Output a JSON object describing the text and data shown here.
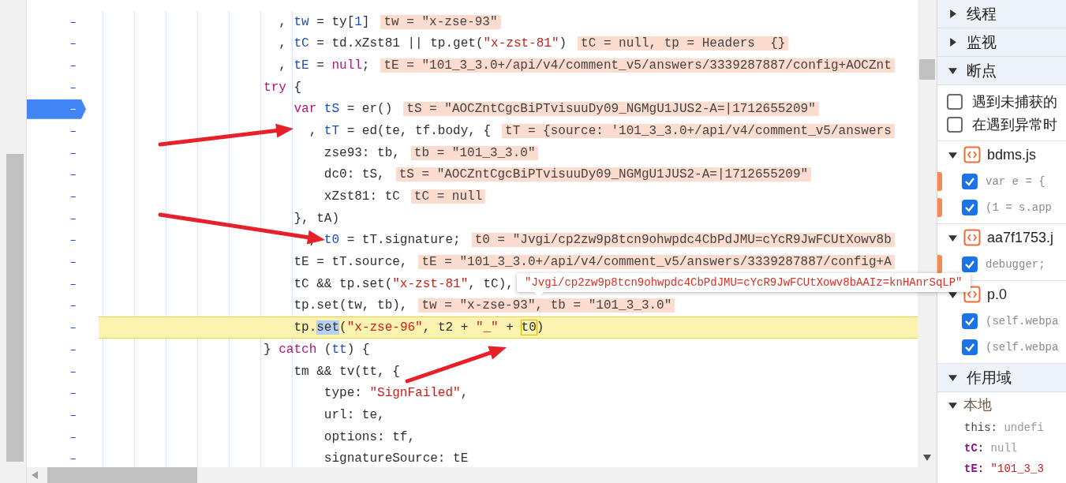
{
  "editor": {
    "lines": [
      {
        "children": [
          {
            "number": "–",
            "tokens": [
              {
                "kind": "plain",
                "text": ", "
              },
              {
                "kind": "var",
                "text": "tw"
              },
              {
                "kind": "plain",
                "text": " = ty["
              },
              {
                "kind": "num",
                "text": "1"
              },
              {
                "kind": "plain",
                "text": "]"
              }
            ],
            "value": "tw = \"x-zse-93\"",
            "paused": false,
            "highlighted": false
          },
          {
            "number": "–",
            "tokens": [
              {
                "kind": "plain",
                "text": ", "
              },
              {
                "kind": "var",
                "text": "tC"
              },
              {
                "kind": "plain",
                "text": " = td.xZst81 || tp.get("
              },
              {
                "kind": "str",
                "text": "\"x-zst-81\""
              },
              {
                "kind": "plain",
                "text": ")"
              }
            ],
            "value": "tC = null, tp = Headers  {}",
            "paused": false,
            "highlighted": false
          },
          {
            "number": "–",
            "tokens": [
              {
                "kind": "plain",
                "text": ", "
              },
              {
                "kind": "var",
                "text": "tE"
              },
              {
                "kind": "plain",
                "text": " = "
              },
              {
                "kind": "kw",
                "text": "null"
              },
              {
                "kind": "plain",
                "text": ";"
              }
            ],
            "value": "tE = \"101_3_3.0+/api/v4/comment_v5/answers/3339287887/config+AOCZnt",
            "paused": false,
            "highlighted": false
          }
        ]
      },
      {
        "number": "–",
        "tokens": [
          {
            "kind": "kw",
            "text": "try"
          },
          {
            "kind": "plain",
            "text": " {"
          }
        ],
        "paused": false,
        "highlighted": false,
        "children": [
          {
            "children": [
              {
                "number": "–",
                "tokens": [
                  {
                    "kind": "kw",
                    "text": "var"
                  },
                  {
                    "kind": "var",
                    "text": " tS"
                  },
                  {
                    "kind": "plain",
                    "text": " = er()"
                  }
                ],
                "value": "tS = \"AOCZntCgcBiPTvisuuDy09_NGMgU1JUS2-A=|1712655209\"",
                "paused": true,
                "highlighted": false,
                "children": [
                  {
                    "number": "–",
                    "tokens": [
                      {
                        "kind": "plain",
                        "text": ", "
                      },
                      {
                        "kind": "var",
                        "text": "tT"
                      },
                      {
                        "kind": "plain",
                        "text": " = ed(te, tf.body, {"
                      }
                    ],
                    "value": "tT = {source: '101_3_3.0+/api/v4/comment_v5/answers",
                    "paused": false,
                    "highlighted": false,
                    "children": [
                      {
                        "number": "–",
                        "tokens": [
                          {
                            "kind": "plain",
                            "text": "zse93: tb,"
                          }
                        ],
                        "value": "tb = \"101_3_3.0\"",
                        "paused": false,
                        "highlighted": false
                      },
                      {
                        "number": "–",
                        "tokens": [
                          {
                            "kind": "plain",
                            "text": "dc0: tS,"
                          }
                        ],
                        "value": "tS = \"AOCZntCgcBiPTvisuuDy09_NGMgU1JUS2-A=|1712655209\"",
                        "paused": false,
                        "highlighted": false
                      },
                      {
                        "number": "–",
                        "tokens": [
                          {
                            "kind": "plain",
                            "text": "xZst81: tC"
                          }
                        ],
                        "value": "tC = null",
                        "paused": false,
                        "highlighted": false
                      }
                    ]
                  }
                ]
              },
              {
                "number": "–",
                "tokens": [
                  {
                    "kind": "plain",
                    "text": "}, tA)"
                  }
                ],
                "paused": false,
                "highlighted": false,
                "children": [
                  {
                    "number": "–",
                    "tokens": [
                      {
                        "kind": "plain",
                        "text": ", "
                      },
                      {
                        "kind": "var",
                        "text": "t0"
                      },
                      {
                        "kind": "plain",
                        "text": " = tT.signature;"
                      }
                    ],
                    "value": "t0 = \"Jvgi/cp2zw9p8tcn9ohwpdc4CbPdJMU=cYcR9JwFCUtXowv8b",
                    "paused": false,
                    "highlighted": false
                  }
                ]
              },
              {
                "number": "–",
                "tokens": [
                  {
                    "kind": "plain",
                    "text": "tE = tT.source,"
                  }
                ],
                "value": "tE = \"101_3_3.0+/api/v4/comment_v5/answers/3339287887/config+A",
                "paused": false,
                "highlighted": false
              },
              {
                "number": "–",
                "tokens": [
                  {
                    "kind": "plain",
                    "text": "tC && tp.set("
                  },
                  {
                    "kind": "str",
                    "text": "\"x-zst-81\""
                  },
                  {
                    "kind": "plain",
                    "text": ", tC),"
                  }
                ],
                "paused": false,
                "highlighted": false
              },
              {
                "number": "–",
                "tokens": [
                  {
                    "kind": "plain",
                    "text": "tp.set(tw, tb),"
                  }
                ],
                "value": "tw = \"x-zse-93\", tb = \"101_3_3.0\"",
                "paused": false,
                "highlighted": false
              },
              {
                "number": "–",
                "tokens": [
                  {
                    "kind": "plain",
                    "text": "tp."
                  },
                  {
                    "kind": "selection",
                    "text": "set"
                  },
                  {
                    "kind": "plain",
                    "text": "("
                  },
                  {
                    "kind": "str",
                    "text": "\"x-zse-96\""
                  },
                  {
                    "kind": "plain",
                    "text": ", t2 + "
                  },
                  {
                    "kind": "str",
                    "text": "\"_\""
                  },
                  {
                    "kind": "plain",
                    "text": " + "
                  },
                  {
                    "kind": "match",
                    "text": "t0"
                  },
                  {
                    "kind": "plain",
                    "text": ")"
                  }
                ],
                "paused": false,
                "highlighted": true
              }
            ]
          }
        ]
      },
      {
        "number": "–",
        "tokens": [
          {
            "kind": "plain",
            "text": "} "
          },
          {
            "kind": "kw",
            "text": "catch"
          },
          {
            "kind": "plain",
            "text": " ("
          },
          {
            "kind": "var",
            "text": "tt"
          },
          {
            "kind": "plain",
            "text": ") {"
          }
        ],
        "paused": false,
        "highlighted": false,
        "children": [
          {
            "children": [
              {
                "number": "–",
                "tokens": [
                  {
                    "kind": "plain",
                    "text": "tm && tv(tt, {"
                  }
                ],
                "paused": false,
                "highlighted": false,
                "children": [
                  {
                    "children": [
                      {
                        "number": "–",
                        "tokens": [
                          {
                            "kind": "plain",
                            "text": "type: "
                          },
                          {
                            "kind": "str",
                            "text": "\"SignFailed\""
                          },
                          {
                            "kind": "plain",
                            "text": ","
                          }
                        ],
                        "paused": false,
                        "highlighted": false
                      },
                      {
                        "number": "–",
                        "tokens": [
                          {
                            "kind": "plain",
                            "text": "url: te,"
                          }
                        ],
                        "paused": false,
                        "highlighted": false
                      },
                      {
                        "number": "–",
                        "tokens": [
                          {
                            "kind": "plain",
                            "text": "options: tf,"
                          }
                        ],
                        "paused": false,
                        "highlighted": false
                      },
                      {
                        "number": "–",
                        "tokens": [
                          {
                            "kind": "plain",
                            "text": "signatureSource: tE"
                          }
                        ],
                        "paused": false,
                        "highlighted": false
                      }
                    ]
                  }
                ]
              }
            ]
          }
        ]
      }
    ],
    "tooltip": {
      "text": "\"Jvgi/cp2zw9p8tcn9ohwpdc4CbPdJMU=cYcR9JwFCUtXowv8bAAIz=knHAnrSqLP\""
    }
  },
  "sidebar": {
    "sections": [
      {
        "title": "线程",
        "expanded": false
      },
      {
        "title": "监视",
        "expanded": false
      },
      {
        "title": "断点",
        "expanded": true,
        "options": [
          {
            "label": "遇到未捕获的",
            "checked": false
          },
          {
            "label": "在遇到异常时",
            "checked": false
          }
        ],
        "files": [
          {
            "name": "bdms.js",
            "expanded": true,
            "breakpoints": [
              {
                "code": "var e = {",
                "checked": true,
                "flagged": true
              },
              {
                "code": "(1 = s.app",
                "checked": true,
                "flagged": true
              }
            ]
          },
          {
            "name": "aa7f1753.j",
            "expanded": true,
            "breakpoints": [
              {
                "code": "debugger;",
                "checked": true,
                "flagged": true
              }
            ]
          },
          {
            "name": "p.0",
            "expanded": true,
            "breakpoints": [
              {
                "code": "(self.webpa",
                "checked": true,
                "flagged": false
              },
              {
                "code": "(self.webpa",
                "checked": true,
                "flagged": false
              }
            ]
          }
        ]
      },
      {
        "title": "作用域",
        "expanded": true,
        "scopes": [
          {
            "title": "本地",
            "expanded": true,
            "variables": [
              {
                "name": "this:",
                "value": "undefi",
                "kind": "this"
              },
              {
                "name": "tC:",
                "value": "null",
                "kind": "null"
              },
              {
                "name": "tE:",
                "value": "\"101_3_3",
                "kind": "string"
              }
            ]
          }
        ]
      }
    ]
  }
}
